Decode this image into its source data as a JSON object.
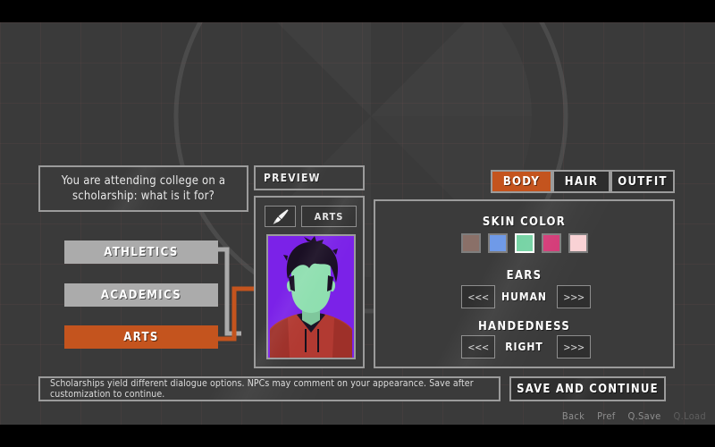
{
  "question": {
    "text": "You are attending college on a scholarship: what is it for?"
  },
  "choices": [
    {
      "label": "ATHLETICS",
      "state": "inactive"
    },
    {
      "label": "ACADEMICS",
      "state": "inactive"
    },
    {
      "label": "ARTS",
      "state": "active"
    }
  ],
  "preview": {
    "header_label": "PREVIEW",
    "brush_icon": "paintbrush-icon",
    "major_label": "ARTS",
    "portrait": {
      "background_color": "#7b22e8",
      "skin_color": "#8fdfb0",
      "hair_color": "#1a0f24",
      "shirt_color": "#b23a32",
      "collar_color": "#1a1426"
    }
  },
  "tabs": [
    {
      "label": "BODY",
      "active": true
    },
    {
      "label": "HAIR",
      "active": false
    },
    {
      "label": "OUTFIT",
      "active": false
    }
  ],
  "options": {
    "skin_color": {
      "title": "SKIN COLOR",
      "swatches": [
        {
          "color": "#8a7068",
          "selected": false
        },
        {
          "color": "#6f9ae8",
          "selected": false
        },
        {
          "color": "#72d2a2",
          "selected": true
        },
        {
          "color": "#d43a77",
          "selected": false
        },
        {
          "color": "#f9d2d5",
          "selected": false
        }
      ]
    },
    "ears": {
      "title": "EARS",
      "value": "HUMAN",
      "prev_label": "<<<",
      "next_label": ">>>"
    },
    "handedness": {
      "title": "HANDEDNESS",
      "value": "RIGHT",
      "prev_label": "<<<",
      "next_label": ">>>"
    }
  },
  "footer": {
    "tooltip": "Scholarships yield different dialogue options. NPCs may comment on your appearance. Save after customization to continue.",
    "save_label": "SAVE AND CONTINUE",
    "quick_menu": [
      {
        "label": "Back",
        "disabled": false
      },
      {
        "label": "Pref",
        "disabled": false
      },
      {
        "label": "Q.Save",
        "disabled": false
      },
      {
        "label": "Q.Load",
        "disabled": true
      }
    ]
  },
  "theme": {
    "accent": "#c4541e",
    "panel_bg": "#3b3b3b",
    "panel_border": "#9b9b9b",
    "stage_bg": "#3a3a3a",
    "inactive_choice": "#ababab"
  }
}
